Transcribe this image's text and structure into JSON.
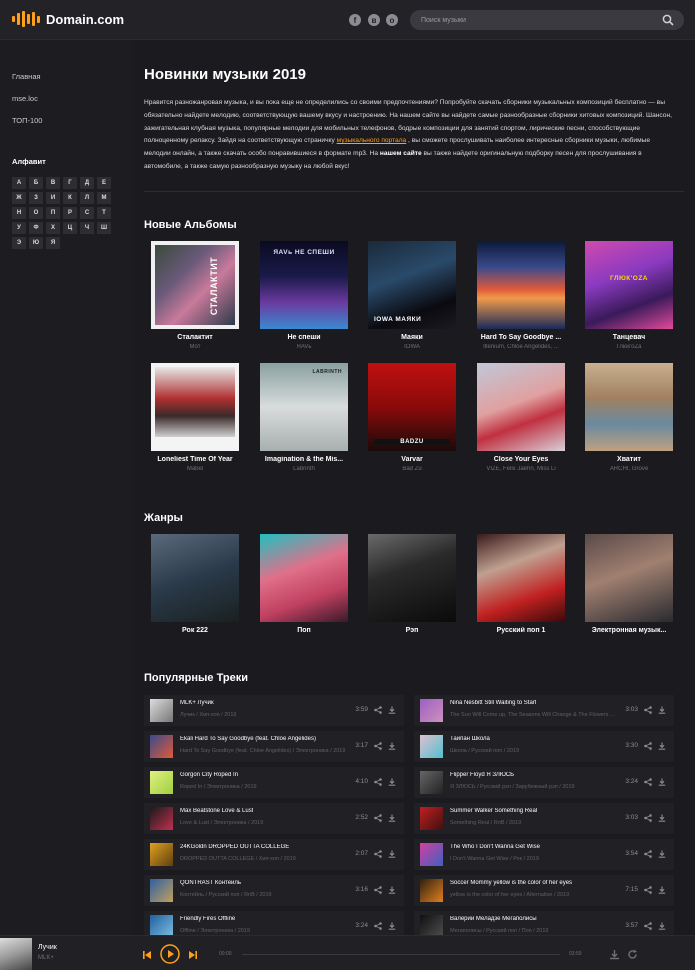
{
  "header": {
    "brand": "Domain.com",
    "social": [
      "f",
      "vk",
      "o"
    ],
    "search_placeholder": "Поиск музыки"
  },
  "sidebar": {
    "nav": [
      "Главная",
      "mse.loc",
      "ТОП-100"
    ],
    "alphabet_title": "Алфавит",
    "letters": [
      "А",
      "Б",
      "В",
      "Г",
      "Д",
      "Е",
      "Ж",
      "З",
      "И",
      "К",
      "Л",
      "М",
      "Н",
      "О",
      "П",
      "Р",
      "С",
      "Т",
      "У",
      "Ф",
      "Х",
      "Ц",
      "Ч",
      "Ш",
      "Э",
      "Ю",
      "Я"
    ]
  },
  "main": {
    "title": "Новинки музыки 2019",
    "intro_1": "Нравится разножанровая музыка, и вы пока еще не определились со своими предпочтениями? Попробуйте скачать сборники музыкальных композиций бесплатно — вы обязательно найдете мелодию, соответствующую вашему вкусу и настроению. На нашем сайте вы найдете самые разнообразные сборники хитовых композиций. Шансон, зажигательная клубная музыка, популярные мелодии для мобильных телефонов, бодрые композиции для занятий спортом, лирические песни, способствующие полноценному релаксу. Зайдя на соответствующую страничку ",
    "intro_link": "музыкального портала",
    "intro_2": " , вы сможете прослушивать наиболее интересные сборники музыки, любимые мелодии онлайн, а также скачать особо понравившиеся в формате mp3. На ",
    "intro_bold": "нашем сайте",
    "intro_3": " вы также найдете оригинальную подборку песен для прослушивания в автомобиле, а также самую разнообразную музыку на любой вкус!",
    "albums_title": "Новые Альбомы",
    "genres_title": "Жанры",
    "tracks_title": "Популярные Треки"
  },
  "albums": [
    {
      "name": "Сталактит",
      "artist": "Мот",
      "cover_text": "СТАЛАКТИТ"
    },
    {
      "name": "Не спеши",
      "artist": "ЯAVь",
      "cover_text": "ЯAVь  НЕ СПЕШИ"
    },
    {
      "name": "Маяки",
      "artist": "IOWA",
      "cover_text": "IOWA МАЯКИ"
    },
    {
      "name": "Hard To Say Goodbye ...",
      "artist": "Illenium, Chloe Angelides, ...",
      "cover_text": ""
    },
    {
      "name": "Танцевач",
      "artist": "Глюк'oZa",
      "cover_text": "ГЛЮК'OZA  ТАНЦЕВАЧ"
    },
    {
      "name": "Loneliest Time Of Year",
      "artist": "Mabel",
      "cover_text": ""
    },
    {
      "name": "Imagination & the Mis...",
      "artist": "Labrinth",
      "cover_text": "LABRINTH"
    },
    {
      "name": "Varvar",
      "artist": "Bad Zu",
      "cover_text": "BADZU"
    },
    {
      "name": "Close Your Eyes",
      "artist": "VIZE, Felix Jaehn, Miss Li",
      "cover_text": ""
    },
    {
      "name": "Хватит",
      "artist": "ARCHI, Grove",
      "cover_text": ""
    }
  ],
  "genres": [
    {
      "name": "Рок 222"
    },
    {
      "name": "Поп"
    },
    {
      "name": "Рэп"
    },
    {
      "name": "Русский поп 1"
    },
    {
      "name": "Электронная музык..."
    }
  ],
  "tracks": [
    {
      "title": "MLK+ Лучик",
      "meta": "Лучик / Хип-хоп / 2019",
      "dur": "3:59"
    },
    {
      "title": "Nina Nesbitt Still Waiting to Start",
      "meta": "The Sun Will Come up, The Seasons Will Change & The Flowers Will Fall / 2019",
      "dur": "3:03"
    },
    {
      "title": "Ekali Hard To Say Goodbye (feat. Chloe Angelides)",
      "meta": "Hard To Say Goodbye (feat. Chloe Angelides) / Электроника / 2019",
      "dur": "3:17"
    },
    {
      "title": "Тайпан Школа",
      "meta": "Школа / Русский поп / 2019",
      "dur": "3:30"
    },
    {
      "title": "Gorgon City Roped In",
      "meta": "Roped In / Электроника / 2019",
      "dur": "4:10"
    },
    {
      "title": "Flipper Floyd Я ЗЛЮСЬ",
      "meta": "Я ЗЛЮСЬ / Русский рэп / Зарубежный рэп / 2019",
      "dur": "3:24"
    },
    {
      "title": "Max Beatstone Love & Lust",
      "meta": "Love & Lust / Электроника / 2019",
      "dur": "2:52"
    },
    {
      "title": "Summer Walker Something Real",
      "meta": "Something Real / RnB / 2019",
      "dur": "3:03"
    },
    {
      "title": "24KGoldn DROPPED OUTTA COLLEGE",
      "meta": "DROPPED OUTTA COLLEGE / Хип-хоп / 2019",
      "dur": "2:07"
    },
    {
      "title": "The Who I Don't Wanna Get Wise",
      "meta": "I Don't Wanna Get Wise / Рок / 2019",
      "dur": "3:54"
    },
    {
      "title": "QONTRAST Контейль",
      "meta": "Контейль / Русский поп / RnB / 2019",
      "dur": "3:16"
    },
    {
      "title": "Soccer Mommy yellow is the color of her eyes",
      "meta": "yellow is the color of her eyes / Alternative / 2019",
      "dur": "7:15"
    },
    {
      "title": "Friendly Fires Offline",
      "meta": "Offline / Электроника / 2019",
      "dur": "3:24"
    },
    {
      "title": "Валерий Меладзе Мегаполисы",
      "meta": "Мегаполисы / Русский поп / Поп / 2019",
      "dur": "3:57"
    }
  ],
  "player": {
    "title": "Лучик",
    "artist": "MLK+",
    "time_start": "00:00",
    "time_end": "03:59"
  },
  "colors": {
    "accent": "#ff9f1a",
    "bg": "#1b1b1f",
    "panel": "#212125"
  }
}
